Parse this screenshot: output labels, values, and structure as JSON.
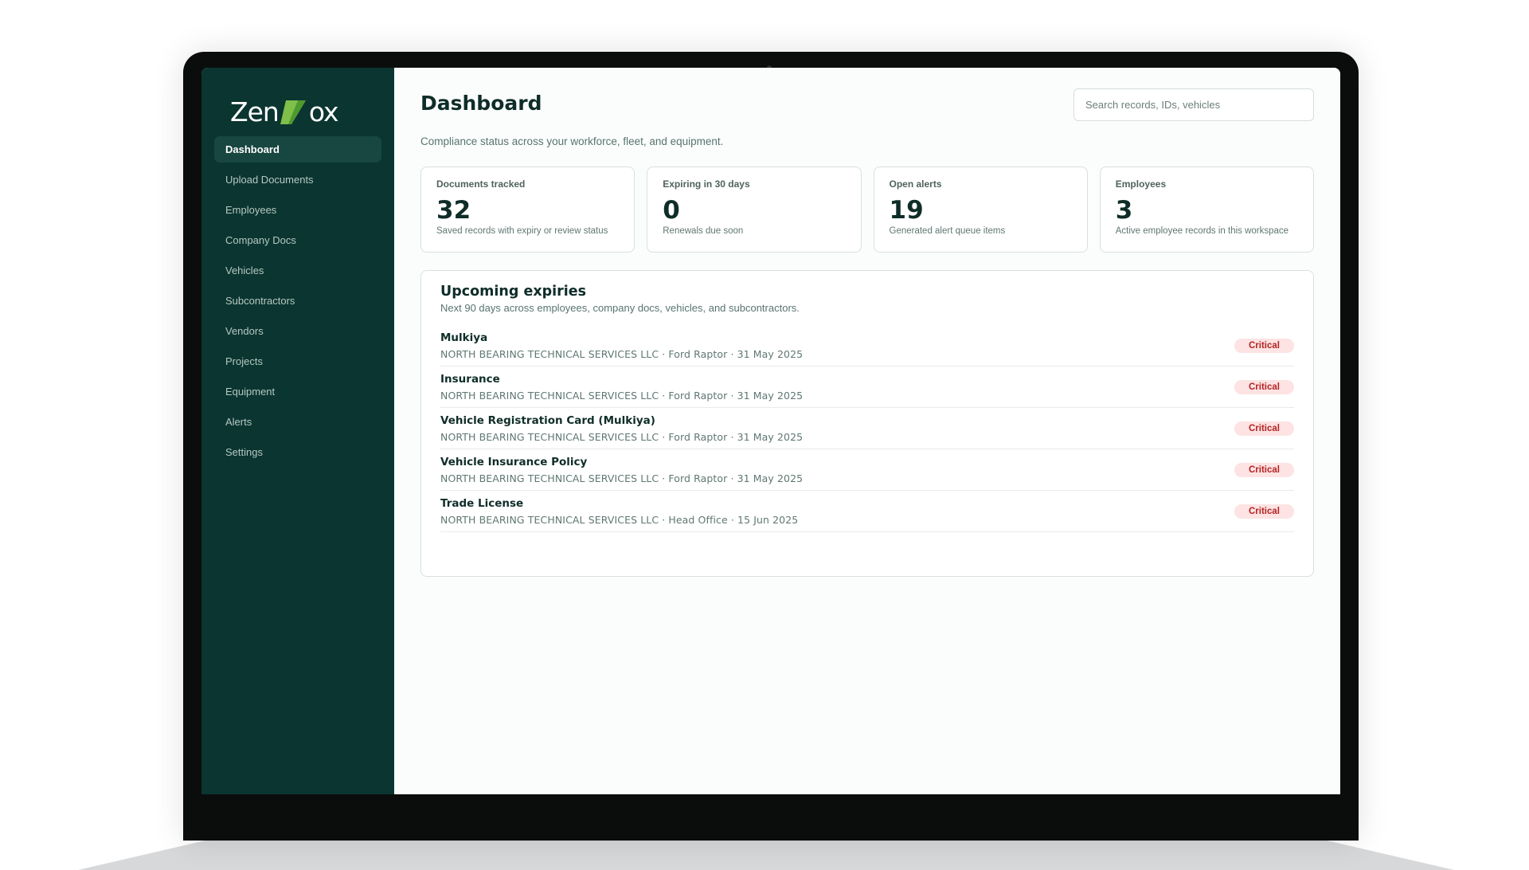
{
  "app": {
    "logo_prefix": "Zen",
    "logo_suffix": "ox"
  },
  "sidebar": {
    "items": [
      {
        "label": "Dashboard",
        "active": true
      },
      {
        "label": "Upload Documents"
      },
      {
        "label": "Employees"
      },
      {
        "label": "Company Docs"
      },
      {
        "label": "Vehicles"
      },
      {
        "label": "Subcontractors"
      },
      {
        "label": "Vendors"
      },
      {
        "label": "Projects"
      },
      {
        "label": "Equipment"
      },
      {
        "label": "Alerts"
      },
      {
        "label": "Settings"
      }
    ]
  },
  "header": {
    "title": "Dashboard",
    "search_placeholder": "Search records, IDs, vehicles",
    "subtitle": "Compliance status across your workforce, fleet, and equipment."
  },
  "stats": [
    {
      "label": "Documents tracked",
      "value": "32",
      "description": "Saved records with expiry or review status"
    },
    {
      "label": "Expiring in 30 days",
      "value": "0",
      "description": "Renewals due soon"
    },
    {
      "label": "Open alerts",
      "value": "19",
      "description": "Generated alert queue items"
    },
    {
      "label": "Employees",
      "value": "3",
      "description": "Active employee records in this workspace"
    }
  ],
  "expiries": {
    "title": "Upcoming expiries",
    "subtitle": "Next 90 days across employees, company docs, vehicles, and subcontractors.",
    "items": [
      {
        "name": "Mulkiya",
        "meta": "NORTH BEARING TECHNICAL SERVICES LLC · Ford Raptor · 31 May 2025",
        "status": "Critical"
      },
      {
        "name": "Insurance",
        "meta": "NORTH BEARING TECHNICAL SERVICES LLC · Ford Raptor · 31 May 2025",
        "status": "Critical"
      },
      {
        "name": "Vehicle Registration Card (Mulkiya)",
        "meta": "NORTH BEARING TECHNICAL SERVICES LLC · Ford Raptor · 31 May 2025",
        "status": "Critical"
      },
      {
        "name": "Vehicle Insurance Policy",
        "meta": "NORTH BEARING TECHNICAL SERVICES LLC · Ford Raptor · 31 May 2025",
        "status": "Critical"
      },
      {
        "name": "Trade License",
        "meta": "NORTH BEARING TECHNICAL SERVICES LLC · Head Office · 15 Jun 2025",
        "status": "Critical"
      }
    ]
  },
  "colors": {
    "sidebar_bg": "#0b3530",
    "accent_green": "#7ec04a",
    "critical_text": "#b42323",
    "critical_bg": "#fde3e3"
  }
}
